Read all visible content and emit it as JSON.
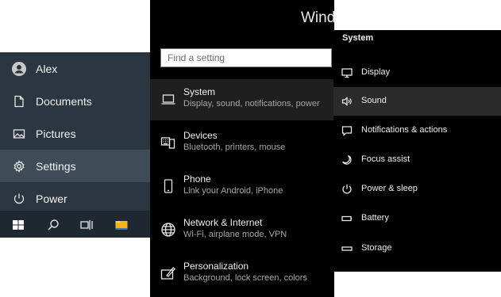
{
  "start_menu": {
    "items": [
      {
        "label": "Alex",
        "icon": "user-avatar-icon"
      },
      {
        "label": "Documents",
        "icon": "document-icon"
      },
      {
        "label": "Pictures",
        "icon": "pictures-icon"
      },
      {
        "label": "Settings",
        "icon": "gear-icon",
        "active": true
      },
      {
        "label": "Power",
        "icon": "power-icon"
      }
    ]
  },
  "taskbar": {
    "icons": [
      "windows-start-icon",
      "search-icon",
      "task-view-icon",
      "file-explorer-icon"
    ]
  },
  "settings": {
    "title": "Wind",
    "search": {
      "placeholder": "Find a setting",
      "value": ""
    },
    "categories": [
      {
        "name": "System",
        "desc": "Display, sound, notifications, power",
        "icon": "laptop-icon",
        "active": true
      },
      {
        "name": "Devices",
        "desc": "Bluetooth, printers, mouse",
        "icon": "keyboard-icon"
      },
      {
        "name": "Phone",
        "desc": "Link your Android, iPhone",
        "icon": "phone-icon"
      },
      {
        "name": "Network & Internet",
        "desc": "Wi-Fi, airplane mode, VPN",
        "icon": "globe-icon"
      },
      {
        "name": "Personalization",
        "desc": "Background, lock screen, colors",
        "icon": "paint-icon"
      }
    ]
  },
  "system_panel": {
    "title": "System",
    "items": [
      {
        "label": "Display",
        "icon": "monitor-icon"
      },
      {
        "label": "Sound",
        "icon": "speaker-icon",
        "active": true
      },
      {
        "label": "Notifications & actions",
        "icon": "notification-icon"
      },
      {
        "label": "Focus assist",
        "icon": "moon-icon"
      },
      {
        "label": "Power & sleep",
        "icon": "power-icon"
      },
      {
        "label": "Battery",
        "icon": "battery-icon"
      },
      {
        "label": "Storage",
        "icon": "storage-icon"
      }
    ]
  },
  "colors": {
    "start_bg": "#2b3640",
    "start_active": "#3e4c58",
    "taskbar_bg": "#1f2830",
    "settings_bg": "#000000",
    "active_row": "#1f1f1f",
    "accent_yellow": "#f3b519",
    "accent_blue": "#2a7fd4"
  }
}
